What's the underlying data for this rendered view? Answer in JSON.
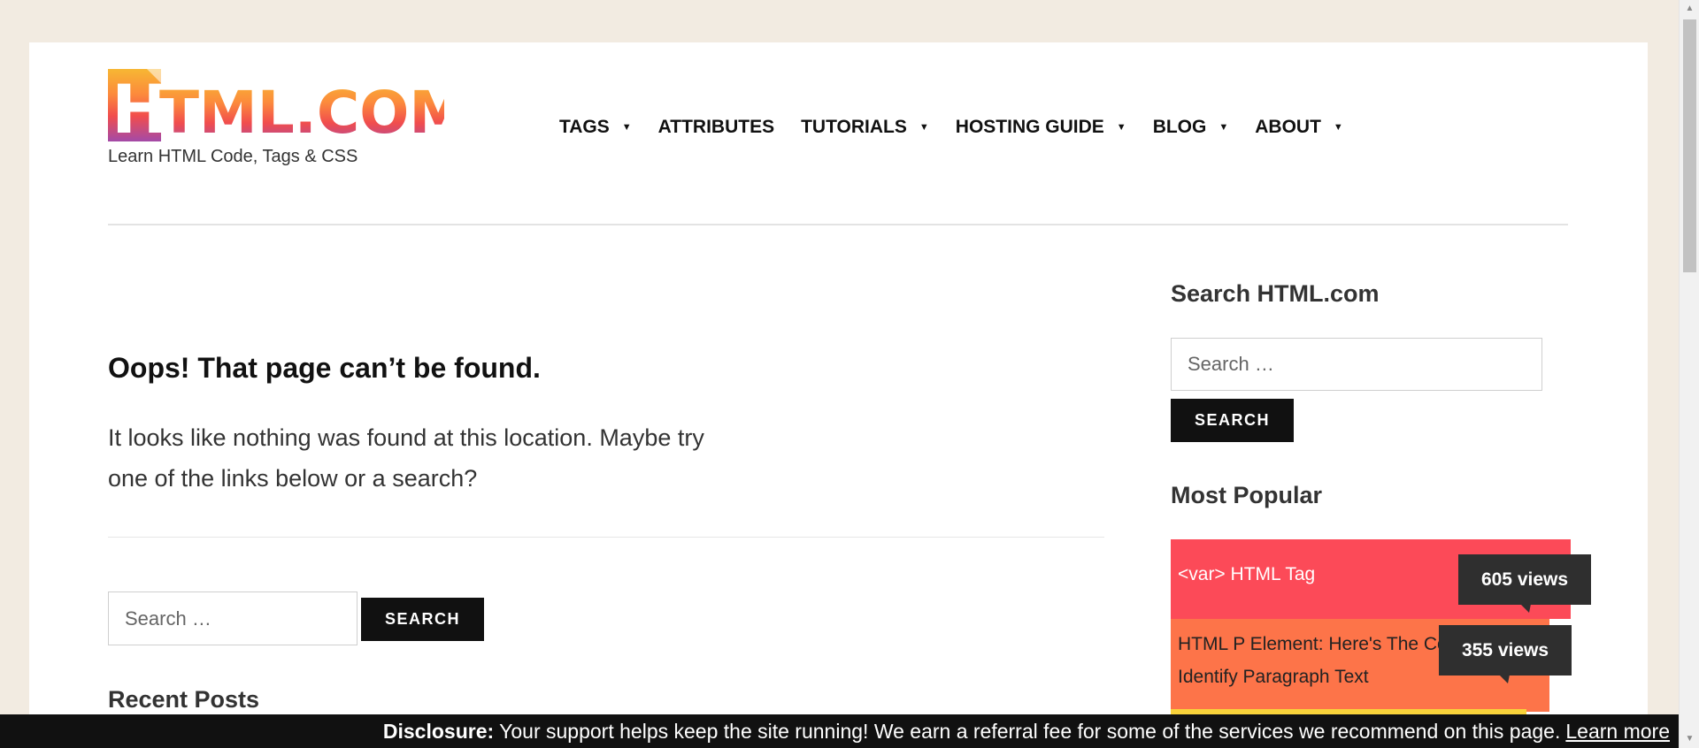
{
  "site": {
    "logo_text": "HTML.COM",
    "tagline": "Learn HTML Code, Tags & CSS"
  },
  "nav": {
    "items": [
      {
        "label": "TAGS",
        "has_dropdown": true
      },
      {
        "label": "ATTRIBUTES",
        "has_dropdown": false
      },
      {
        "label": "TUTORIALS",
        "has_dropdown": true
      },
      {
        "label": "HOSTING GUIDE",
        "has_dropdown": true
      },
      {
        "label": "BLOG",
        "has_dropdown": true
      },
      {
        "label": "ABOUT",
        "has_dropdown": true
      }
    ]
  },
  "main": {
    "title": "Oops! That page can’t be found.",
    "text": "It looks like nothing was found at this location. Maybe try one of the links below or a search?",
    "search_placeholder": "Search …",
    "search_button": "SEARCH",
    "recent_posts_heading": "Recent Posts"
  },
  "sidebar": {
    "search_heading": "Search HTML.com",
    "search_placeholder": "Search …",
    "search_button": "SEARCH",
    "popular_heading": "Most Popular",
    "popular": [
      {
        "title": "<var> HTML Tag",
        "views": "605 views",
        "color": "#fc4a58"
      },
      {
        "title": "HTML P Element: Here's The Code To Identify Paragraph Text",
        "views": "355 views",
        "color": "#fd7449"
      },
      {
        "title": "",
        "views": "",
        "color": "#f8d23a"
      }
    ]
  },
  "disclosure": {
    "label": "Disclosure:",
    "text": "Your support helps keep the site running! We earn a referral fee for some of the services we recommend on this page.",
    "link": "Learn more"
  },
  "colors": {
    "page_background": "#f2ebe1",
    "button": "#111111",
    "accent_red": "#fc4a58",
    "accent_orange": "#fd7449",
    "accent_yellow": "#f8d23a"
  }
}
